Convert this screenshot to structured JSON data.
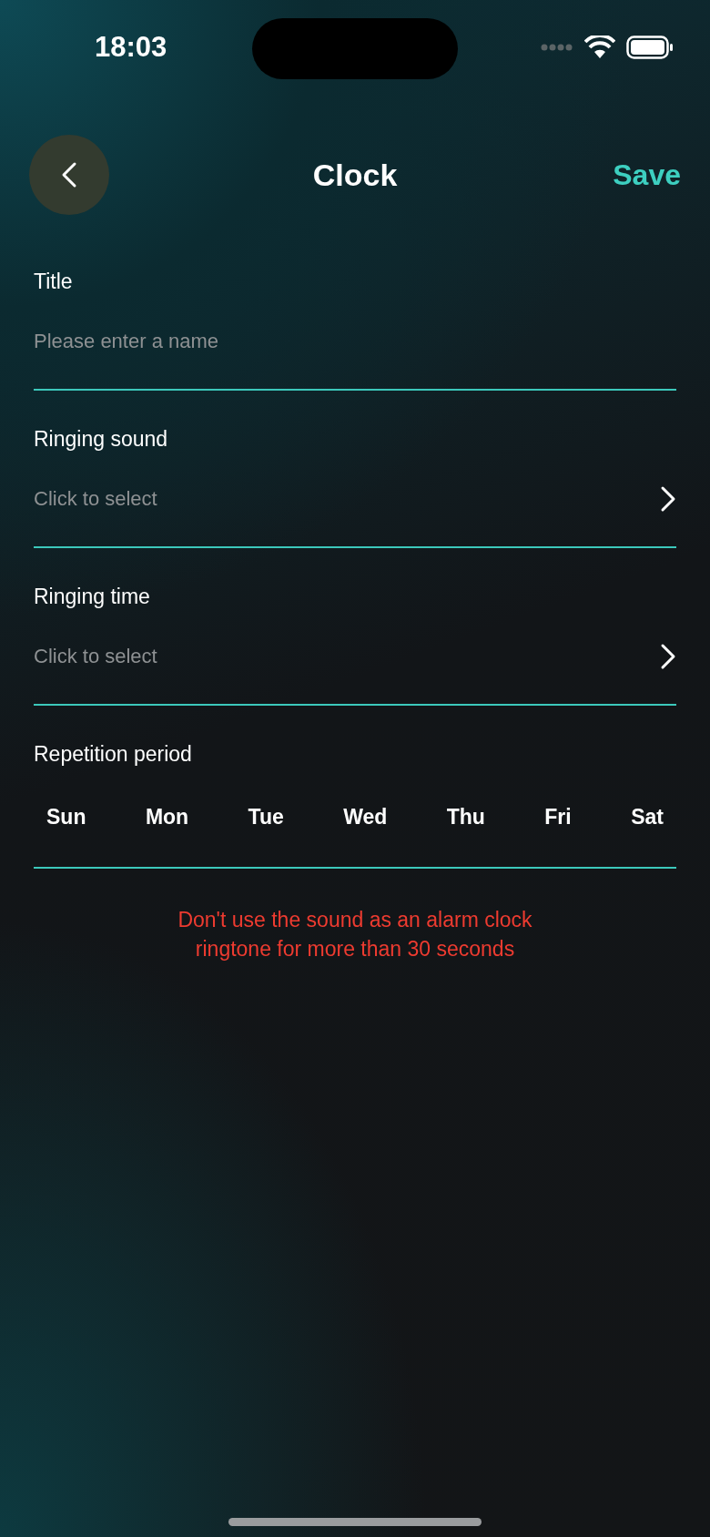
{
  "status_bar": {
    "time": "18:03"
  },
  "header": {
    "title": "Clock",
    "action": "Save"
  },
  "fields": [
    {
      "kind": "text",
      "label": "Title",
      "placeholder": "Please enter a name"
    },
    {
      "kind": "select",
      "label": "Ringing sound",
      "placeholder": "Click to select"
    },
    {
      "kind": "select",
      "label": "Ringing time",
      "placeholder": "Click to select"
    }
  ],
  "repetition": {
    "label": "Repetition period",
    "days": [
      {
        "label": "Sun",
        "selected": false
      },
      {
        "label": "Mon",
        "selected": false
      },
      {
        "label": "Tue",
        "selected": false
      },
      {
        "label": "Wed",
        "selected": false
      },
      {
        "label": "Thu",
        "selected": false
      },
      {
        "label": "Fri",
        "selected": false
      },
      {
        "label": "Sat",
        "selected": false
      }
    ]
  },
  "warning": "Don't use the sound as an alarm clock ringtone for more than 30 seconds"
}
